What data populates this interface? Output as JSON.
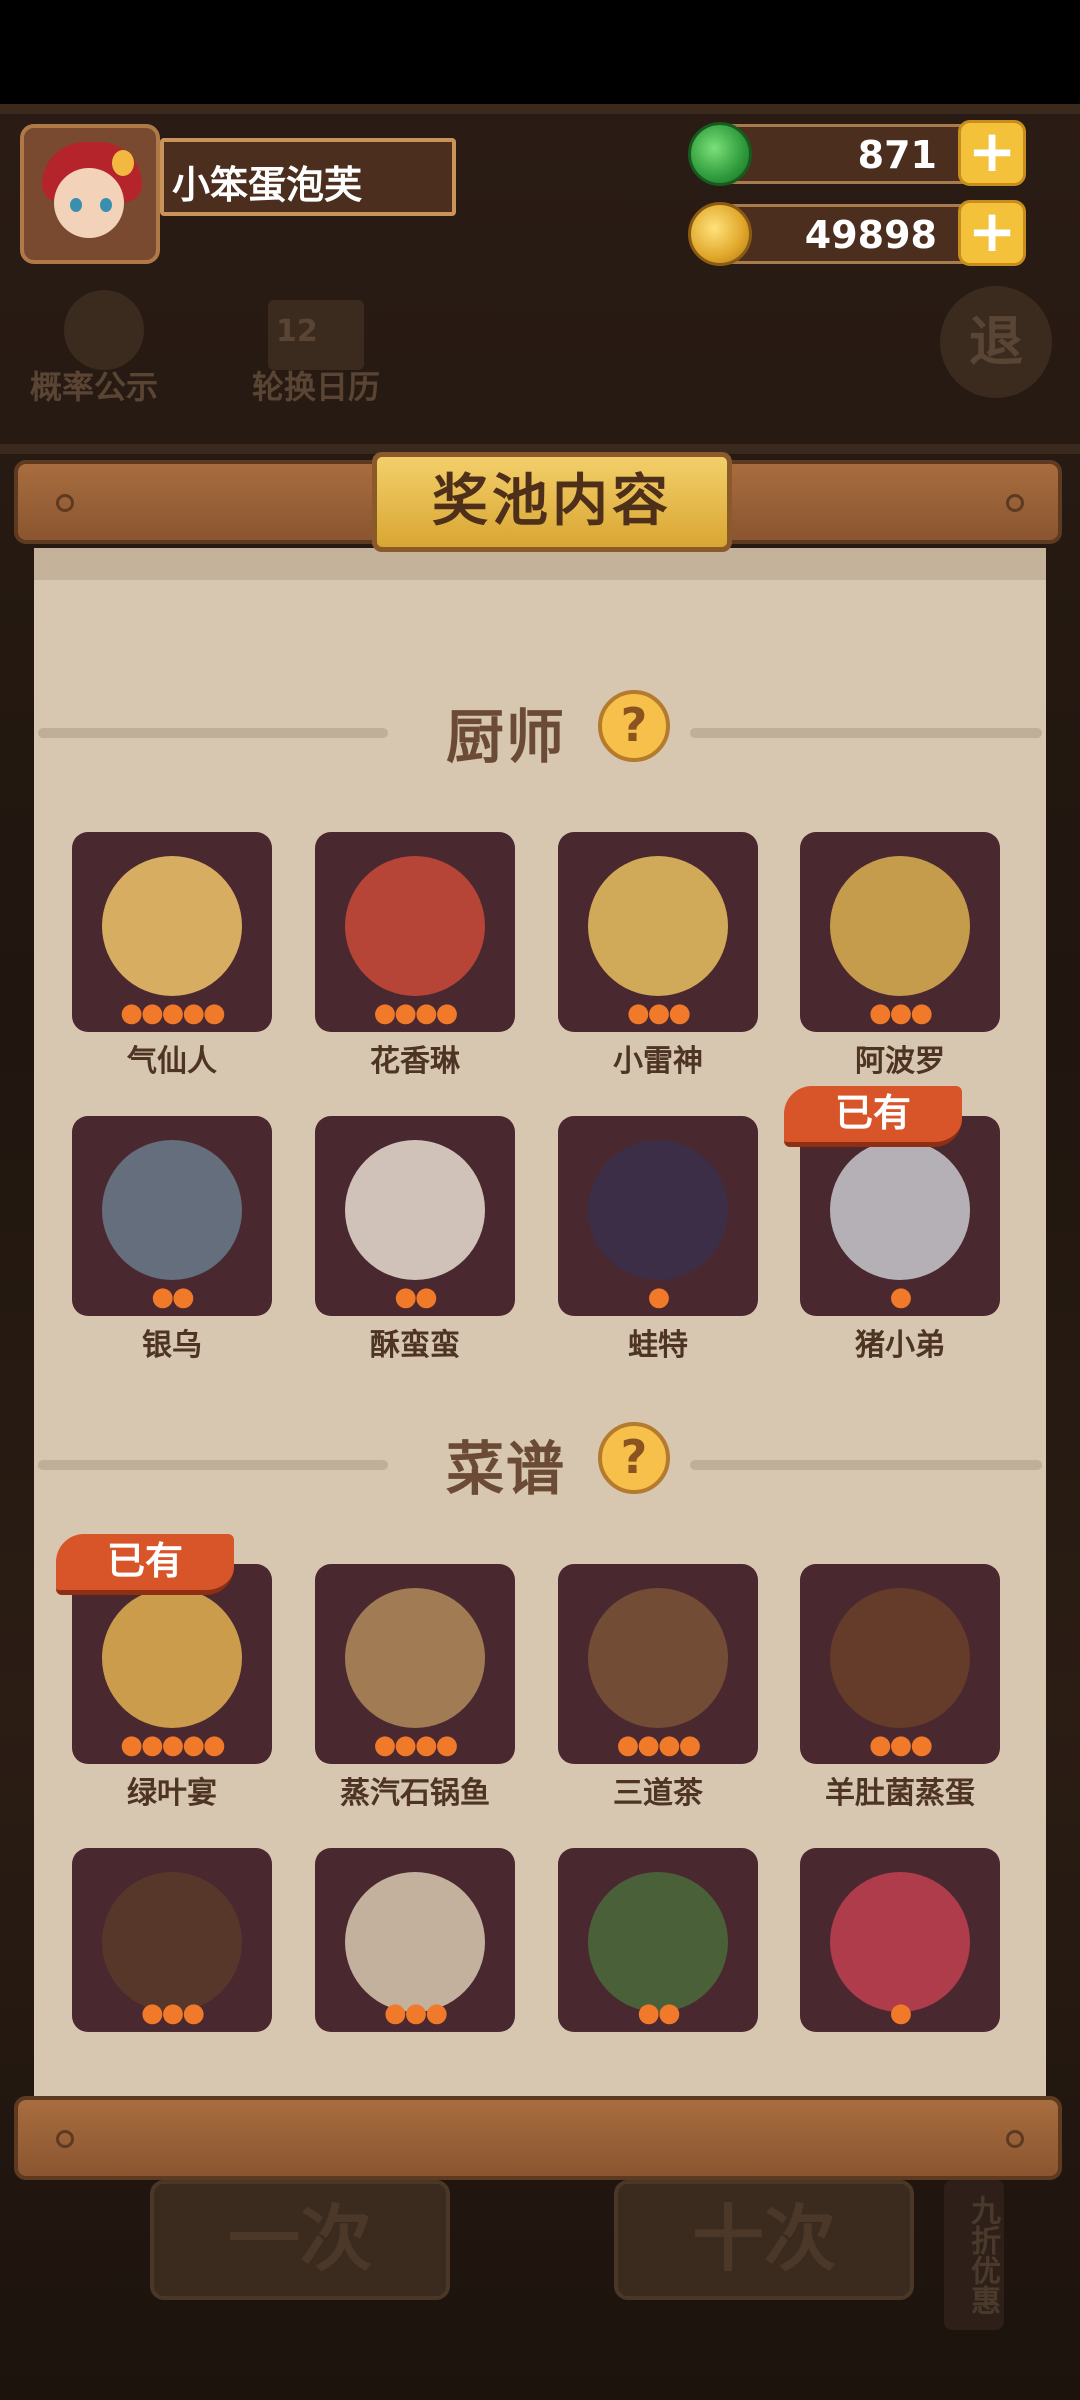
{
  "player": {
    "name": "小笨蛋泡芙"
  },
  "currencies": [
    {
      "name": "jade",
      "value": "871",
      "icon": "jade-coin-icon"
    },
    {
      "name": "gold",
      "value": "49898",
      "icon": "gold-coin-icon"
    }
  ],
  "background": {
    "probability_label": "概率公示",
    "calendar_label": "轮换日历",
    "calendar_day": "12",
    "exit_label": "退",
    "one_draw_label": "一次",
    "ten_draw_label": "十次",
    "discount_label": "九折优惠"
  },
  "modal": {
    "title": "奖池内容",
    "sections": [
      {
        "title": "厨师",
        "items": [
          {
            "name": "气仙人",
            "stars": 5,
            "owned": false
          },
          {
            "name": "花香琳",
            "stars": 4,
            "owned": false
          },
          {
            "name": "小雷神",
            "stars": 3,
            "owned": false
          },
          {
            "name": "阿波罗",
            "stars": 3,
            "owned": false
          },
          {
            "name": "银乌",
            "stars": 2,
            "owned": false
          },
          {
            "name": "酥蛮蛮",
            "stars": 2,
            "owned": false
          },
          {
            "name": "蛙特",
            "stars": 1,
            "owned": false
          },
          {
            "name": "猪小弟",
            "stars": 1,
            "owned": true
          }
        ]
      },
      {
        "title": "菜谱",
        "items": [
          {
            "name": "绿叶宴",
            "stars": 5,
            "owned": true
          },
          {
            "name": "蒸汽石锅鱼",
            "stars": 4,
            "owned": false
          },
          {
            "name": "三道茶",
            "stars": 4,
            "owned": false
          },
          {
            "name": "羊肚菌蒸蛋",
            "stars": 3,
            "owned": false
          },
          {
            "name": "",
            "stars": 3,
            "owned": false
          },
          {
            "name": "",
            "stars": 3,
            "owned": false
          },
          {
            "name": "",
            "stars": 2,
            "owned": false
          },
          {
            "name": "",
            "stars": 1,
            "owned": false
          }
        ]
      }
    ],
    "owned_label": "已有",
    "help_symbol": "?"
  },
  "colors": {
    "owned_badge": "#d8552a",
    "card_bg": "#4a2830",
    "flame": "#f07a2a"
  }
}
